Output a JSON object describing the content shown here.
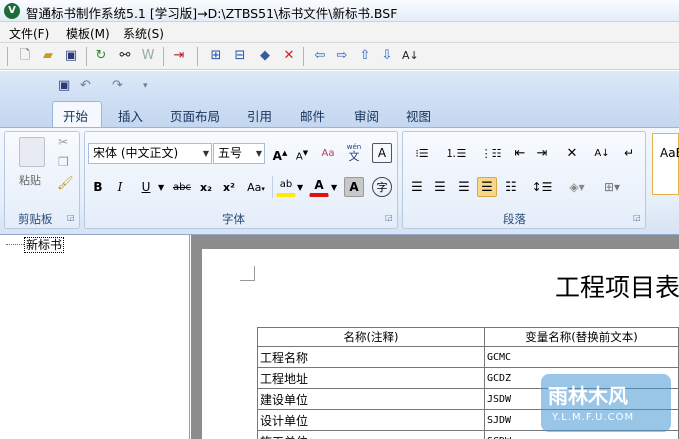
{
  "window": {
    "title": "智通标书制作系统5.1 [学习版]→D:\\ZTBS51\\标书文件\\新标书.BSF",
    "app_icon": "app-logo-icon"
  },
  "menubar": {
    "items": [
      "文件(F)",
      "模板(M)",
      "系统(S)"
    ]
  },
  "toolbar": {
    "icons": [
      "new-doc-icon",
      "open-folder-icon",
      "save-icon",
      "refresh-icon",
      "find-icon",
      "word-icon",
      "exit-icon",
      "tree-add-icon",
      "tree-add-child-icon",
      "template-icon",
      "delete-icon",
      "arrow-left-icon",
      "arrow-right-icon",
      "arrow-up-icon",
      "arrow-down-icon",
      "sort-icon"
    ]
  },
  "quick_access": {
    "icons": [
      "save-icon",
      "undo-icon",
      "redo-icon",
      "customize-icon"
    ]
  },
  "ribbon": {
    "tabs": [
      "开始",
      "插入",
      "页面布局",
      "引用",
      "邮件",
      "审阅",
      "视图"
    ],
    "active_tab": "开始",
    "clipboard": {
      "label": "剪贴板",
      "paste": "粘贴"
    },
    "font": {
      "label": "字体",
      "font_name": "宋体 (中文正文)",
      "font_size": "五号",
      "bold": "B",
      "italic": "I",
      "underline": "U",
      "strike": "abc",
      "subscript": "x₂",
      "superscript": "x²",
      "change_case": "Aa",
      "highlight": "ab",
      "color_a": "A",
      "char_shading": "A",
      "enclose": "字",
      "phonetic": "wén",
      "border": "A",
      "clear": "Aa",
      "grow": "A",
      "shrink": "A"
    },
    "paragraph": {
      "label": "段落"
    },
    "styles": {
      "preview": "AaB"
    }
  },
  "tree": {
    "root": "新标书"
  },
  "document": {
    "title": "工程项目表",
    "table": {
      "headers": [
        "名称(注释)",
        "变量名称(替换前文本)"
      ],
      "rows": [
        [
          "工程名称",
          "GCMC"
        ],
        [
          "工程地址",
          "GCDZ"
        ],
        [
          "建设单位",
          "JSDW"
        ],
        [
          "设计单位",
          "SJDW"
        ],
        [
          "施工单位",
          "SGDW"
        ]
      ]
    }
  },
  "watermark": {
    "main": "雨林木风",
    "sub": "Y.L.M.F.U.COM"
  },
  "colors": {
    "accent": "#c4d7f0",
    "highlight": "#f9d78a",
    "delete": "#d02020",
    "arrow": "#1f5fbf"
  }
}
